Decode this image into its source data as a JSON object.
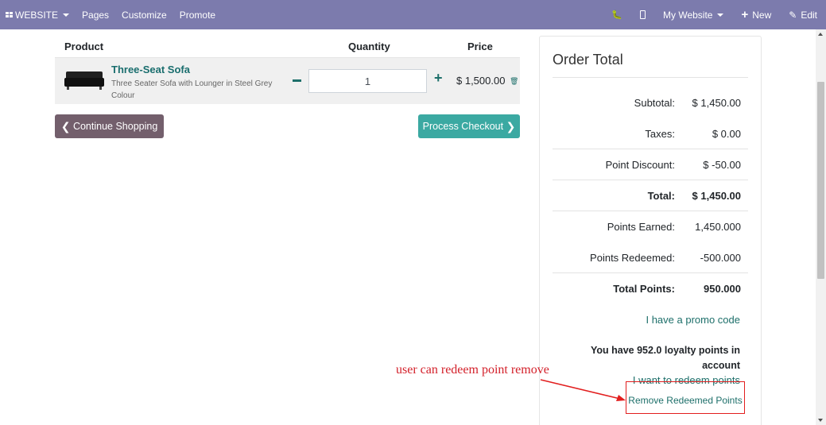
{
  "navbar": {
    "brand_label": "WEBSITE",
    "links": [
      "Pages",
      "Customize",
      "Promote"
    ],
    "website_selector": "My Website",
    "new_label": "New",
    "edit_label": "Edit"
  },
  "cart": {
    "headers": {
      "product": "Product",
      "quantity": "Quantity",
      "price": "Price"
    },
    "line": {
      "name": "Three-Seat Sofa",
      "description": "Three Seater Sofa with Lounger in Steel Grey Colour",
      "quantity": "1",
      "price": "$ 1,500.00"
    },
    "continue_label": "Continue Shopping",
    "checkout_label": "Process Checkout"
  },
  "order_total": {
    "title": "Order Total",
    "rows": [
      {
        "label": "Subtotal:",
        "value": "$ 1,450.00"
      },
      {
        "label": "Taxes:",
        "value": "$ 0.00"
      },
      {
        "label": "Point Discount:",
        "value": "$ -50.00"
      },
      {
        "label": "Total:",
        "value": "$ 1,450.00"
      },
      {
        "label": "Points Earned:",
        "value": "1,450.000"
      },
      {
        "label": "Points Redeemed:",
        "value": "-500.000"
      },
      {
        "label": "Total Points:",
        "value": "950.000"
      }
    ],
    "promo_link": "I have a promo code",
    "loyalty_message": "You have 952.0 loyalty points in account",
    "redeem_link": "I want to redeem points",
    "remove_link": "Remove Redeemed Points"
  },
  "annotation": {
    "text": "user can redeem point remove",
    "color": "#d3202a"
  },
  "colors": {
    "navbar": "#7c7bad",
    "link": "#1d6f6a",
    "continue_button": "#735f6c",
    "checkout_button": "#3ba9a2"
  }
}
